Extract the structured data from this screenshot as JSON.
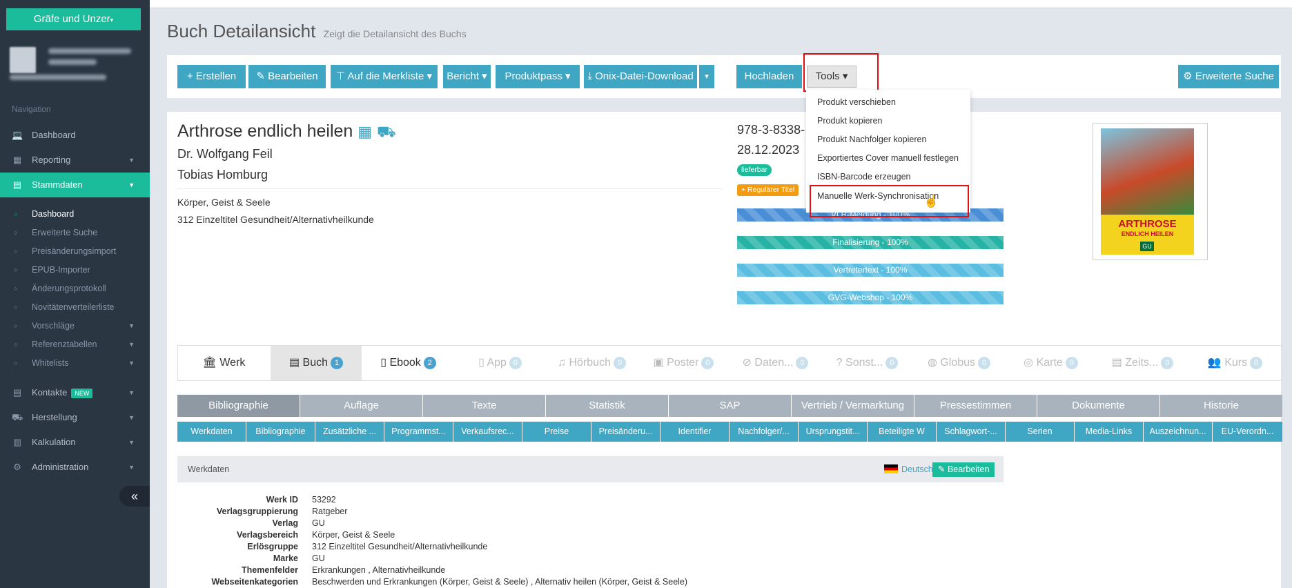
{
  "sidebar": {
    "company": "Gräfe und Unzer",
    "nav_heading": "Navigation",
    "items": [
      {
        "label": "Dashboard",
        "icon": "laptop-icon"
      },
      {
        "label": "Reporting",
        "icon": "grid-icon"
      },
      {
        "label": "Stammdaten",
        "icon": "book-icon"
      }
    ],
    "stammdaten_sub": [
      "Dashboard",
      "Erweiterte Suche",
      "Preisänderungsimport",
      "EPUB-Importer",
      "Änderungsprotokoll",
      "Novitätenverteilerliste",
      "Vorschläge",
      "Referenztabellen",
      "Whitelists"
    ],
    "bottom_items": [
      {
        "label": "Kontakte",
        "badge": "NEW",
        "icon": "book-icon"
      },
      {
        "label": "Herstellung",
        "icon": "truck-icon"
      },
      {
        "label": "Kalkulation",
        "icon": "calculator-icon"
      },
      {
        "label": "Administration",
        "icon": "gear-icon"
      }
    ],
    "collapse": "«"
  },
  "header": {
    "title": "Buch Detailansicht",
    "subtitle": "Zeigt die Detailansicht des Buchs"
  },
  "toolbar": {
    "erstellen": "+ Erstellen",
    "bearbeiten": "✎ Bearbeiten",
    "merkliste": "Auf die Merkliste ▾",
    "bericht": "Bericht ▾",
    "produktpass": "Produktpass ▾",
    "onix": "⤓ Onix-Datei-Download",
    "onix_caret": "▾",
    "hochladen": "Hochladen",
    "tools": "Tools ▾",
    "erweiterte_suche": "Erweiterte Suche"
  },
  "tools_menu": [
    "Produkt verschieben",
    "Produkt kopieren",
    "Produkt Nachfolger kopieren",
    "Exportiertes Cover manuell festlegen",
    "ISBN-Barcode erzeugen",
    "Manuelle Werk-Synchronisation"
  ],
  "book": {
    "title": "Arthrose endlich heilen",
    "authors": [
      "Dr. Wolfgang Feil",
      "Tobias Homburg"
    ],
    "category": "Körper, Geist & Seele",
    "group": "312 Einzeltitel Gesundheit/Alternativheilkunde",
    "isbn": "978-3-8338-",
    "date": "28.12.2023",
    "status": "lieferbar",
    "type_badge": "+ Regulärer Titel",
    "progress": [
      {
        "label": "VLB-Meldung - 100%",
        "value": 100,
        "color": "#4a8fd6"
      },
      {
        "label": "Finalisierung - 100%",
        "value": 100,
        "color": "#26b3a5"
      },
      {
        "label": "Vertretertext - 100%",
        "value": 100,
        "color": "#5bbde0"
      },
      {
        "label": "GVG-Webshop - 100%",
        "value": 100,
        "color": "#5bbde0"
      }
    ],
    "cover": {
      "title": "ARTHROSE",
      "subtitle": "ENDLICH HEILEN",
      "brand": "GU"
    }
  },
  "product_tabs": [
    {
      "label": "Werk",
      "count": null,
      "icon": "bank-icon"
    },
    {
      "label": "Buch",
      "count": "1",
      "icon": "book-icon"
    },
    {
      "label": "Ebook",
      "count": "2",
      "icon": "file-icon"
    },
    {
      "label": "App",
      "count": "0",
      "icon": "mobile-icon"
    },
    {
      "label": "Hörbuch",
      "count": "0",
      "icon": "headphones-icon"
    },
    {
      "label": "Poster",
      "count": "0",
      "icon": "image-icon"
    },
    {
      "label": "Daten...",
      "count": "0",
      "icon": "ban-icon"
    },
    {
      "label": "Sonst...",
      "count": "0",
      "icon": "question-icon"
    },
    {
      "label": "Globus",
      "count": "0",
      "icon": "globe-icon"
    },
    {
      "label": "Karte",
      "count": "0",
      "icon": "compass-icon"
    },
    {
      "label": "Zeits...",
      "count": "0",
      "icon": "newspaper-icon"
    },
    {
      "label": "Kurs",
      "count": "0",
      "icon": "users-icon"
    }
  ],
  "section_tabs": [
    "Bibliographie",
    "Auflage",
    "Texte",
    "Statistik",
    "SAP",
    "Vertrieb / Vermarktung",
    "Pressestimmen",
    "Dokumente",
    "Historie"
  ],
  "sub_tabs": [
    "Werkdaten",
    "Bibliographie",
    "Zusätzliche ...",
    "Programmst...",
    "Verkaufsrec...",
    "Preise",
    "Preisänderu...",
    "Identifier",
    "Nachfolger/...",
    "Ursprungstit...",
    "Beteiligte W",
    "Schlagwort-...",
    "Serien",
    "Media-Links",
    "Auszeichnun...",
    "EU-Verordn..."
  ],
  "werkdaten": {
    "heading": "Werkdaten",
    "language": "Deutsch ▾",
    "edit": "✎ Bearbeiten",
    "rows": [
      {
        "label": "Werk ID",
        "value": "53292"
      },
      {
        "label": "Verlagsgruppierung",
        "value": "Ratgeber"
      },
      {
        "label": "Verlag",
        "value": "GU"
      },
      {
        "label": "Verlagsbereich",
        "value": "Körper, Geist & Seele"
      },
      {
        "label": "Erlösgruppe",
        "value": "312 Einzeltitel Gesundheit/Alternativheilkunde"
      },
      {
        "label": "Marke",
        "value": "GU"
      },
      {
        "label": "Themenfelder",
        "value": "Erkrankungen , Alternativheilkunde"
      },
      {
        "label": "Webseitenkategorien",
        "value": "Beschwerden und Erkrankungen (Körper, Geist & Seele) , Alternativ heilen (Körper, Geist & Seele)"
      }
    ]
  },
  "colors": {
    "accent": "#1bbc9b",
    "primary": "#3fa6c4",
    "sidebar": "#2b3643",
    "highlight": "#e01010"
  }
}
